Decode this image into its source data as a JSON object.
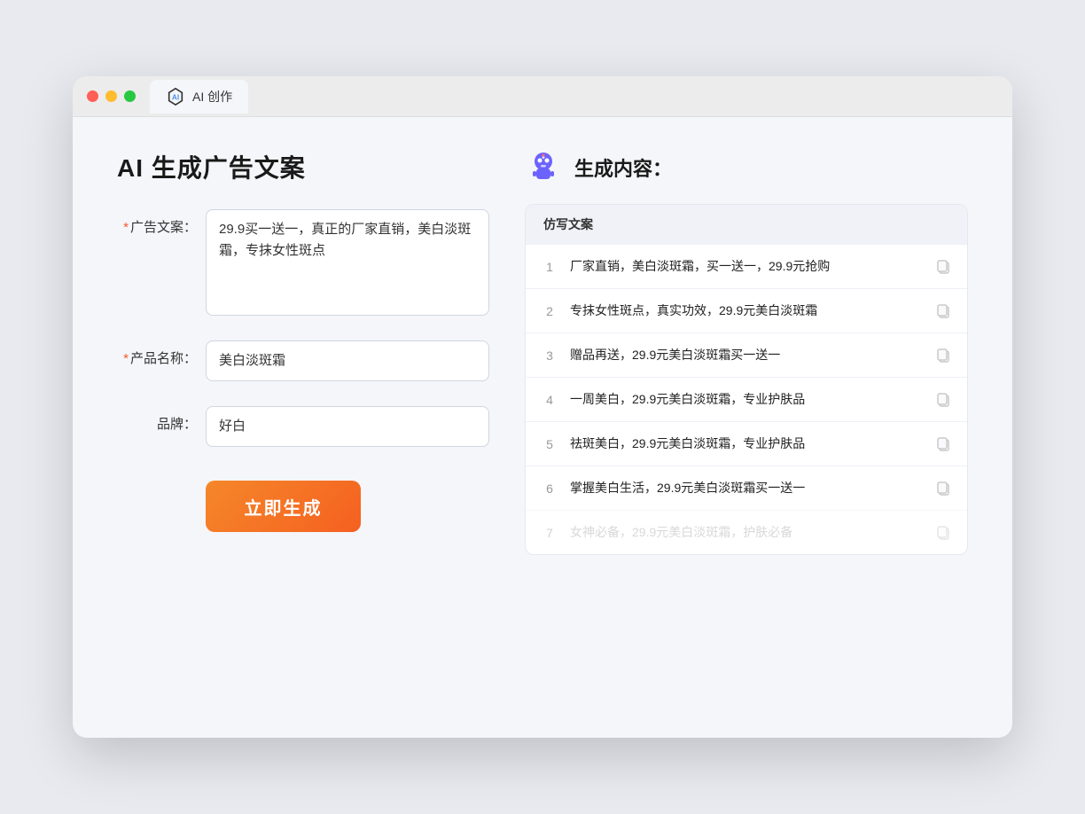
{
  "browser": {
    "tab_title": "AI 创作"
  },
  "page": {
    "title": "AI 生成广告文案"
  },
  "form": {
    "ad_label": "广告文案：",
    "ad_required": true,
    "ad_value": "29.9买一送一，真正的厂家直销，美白淡斑霜，专抹女性斑点",
    "product_label": "产品名称：",
    "product_required": true,
    "product_value": "美白淡斑霜",
    "brand_label": "品牌：",
    "brand_required": false,
    "brand_value": "好白",
    "generate_btn": "立即生成"
  },
  "result": {
    "header_title": "生成内容：",
    "table_header": "仿写文案",
    "rows": [
      {
        "num": "1",
        "text": "厂家直销，美白淡斑霜，买一送一，29.9元抢购"
      },
      {
        "num": "2",
        "text": "专抹女性斑点，真实功效，29.9元美白淡斑霜"
      },
      {
        "num": "3",
        "text": "赠品再送，29.9元美白淡斑霜买一送一"
      },
      {
        "num": "4",
        "text": "一周美白，29.9元美白淡斑霜，专业护肤品"
      },
      {
        "num": "5",
        "text": "祛斑美白，29.9元美白淡斑霜，专业护肤品"
      },
      {
        "num": "6",
        "text": "掌握美白生活，29.9元美白淡斑霜买一送一"
      },
      {
        "num": "7",
        "text": "女神必备，29.9元美白淡斑霜，护肤必备",
        "faded": true
      }
    ]
  }
}
